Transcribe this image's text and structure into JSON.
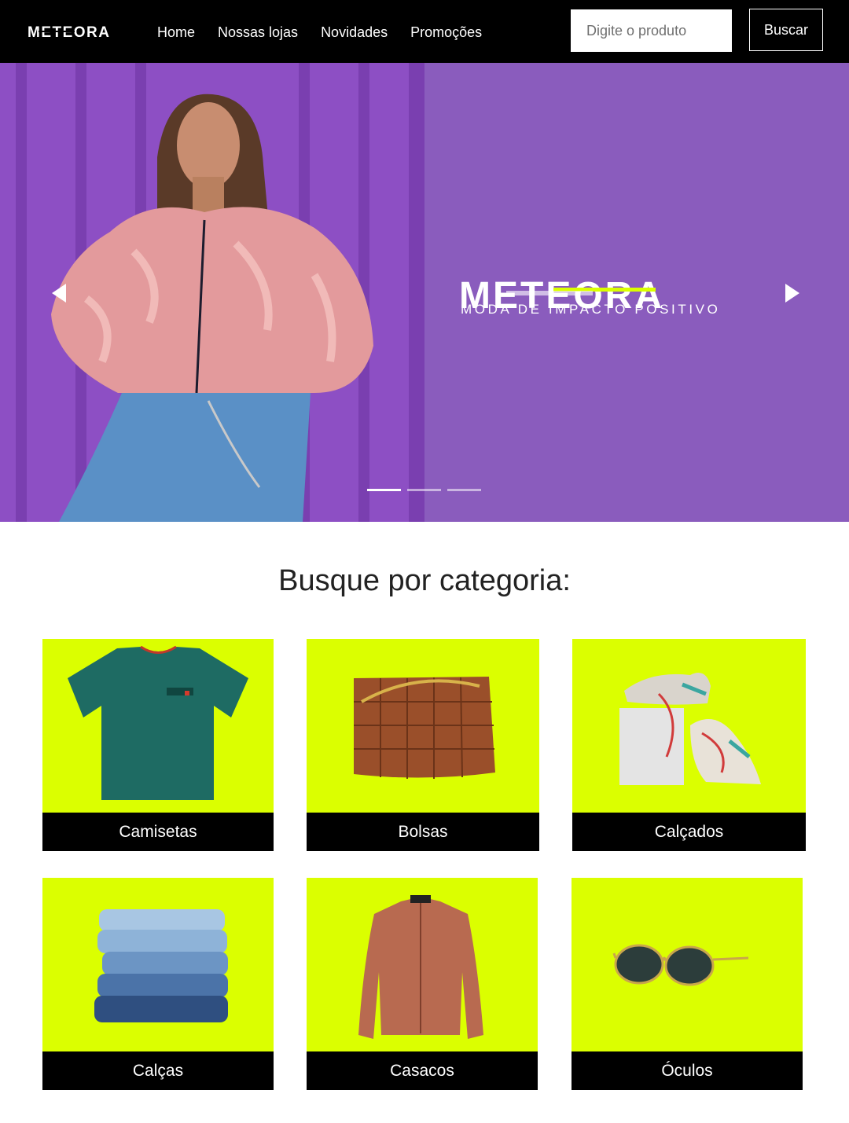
{
  "header": {
    "logo_text": "METEORA",
    "nav": [
      {
        "label": "Home"
      },
      {
        "label": "Nossas lojas"
      },
      {
        "label": "Novidades"
      },
      {
        "label": "Promoções"
      }
    ],
    "search": {
      "placeholder": "Digite o produto",
      "value": ""
    },
    "search_button": "Buscar"
  },
  "hero": {
    "brand": "METEORA",
    "tagline": "MODA DE IMPACTO POSITIVO",
    "slides_total": 3,
    "active_slide": 1,
    "background_color": "#8a5cbd"
  },
  "categories": {
    "title": "Busque por categoria:",
    "accent_color": "#dbff00",
    "items": [
      {
        "label": "Camisetas",
        "icon": "tshirt-image"
      },
      {
        "label": "Bolsas",
        "icon": "handbag-image"
      },
      {
        "label": "Calçados",
        "icon": "sneakers-image"
      },
      {
        "label": "Calças",
        "icon": "jeans-image"
      },
      {
        "label": "Casacos",
        "icon": "jacket-image"
      },
      {
        "label": "Óculos",
        "icon": "sunglasses-image"
      }
    ]
  }
}
